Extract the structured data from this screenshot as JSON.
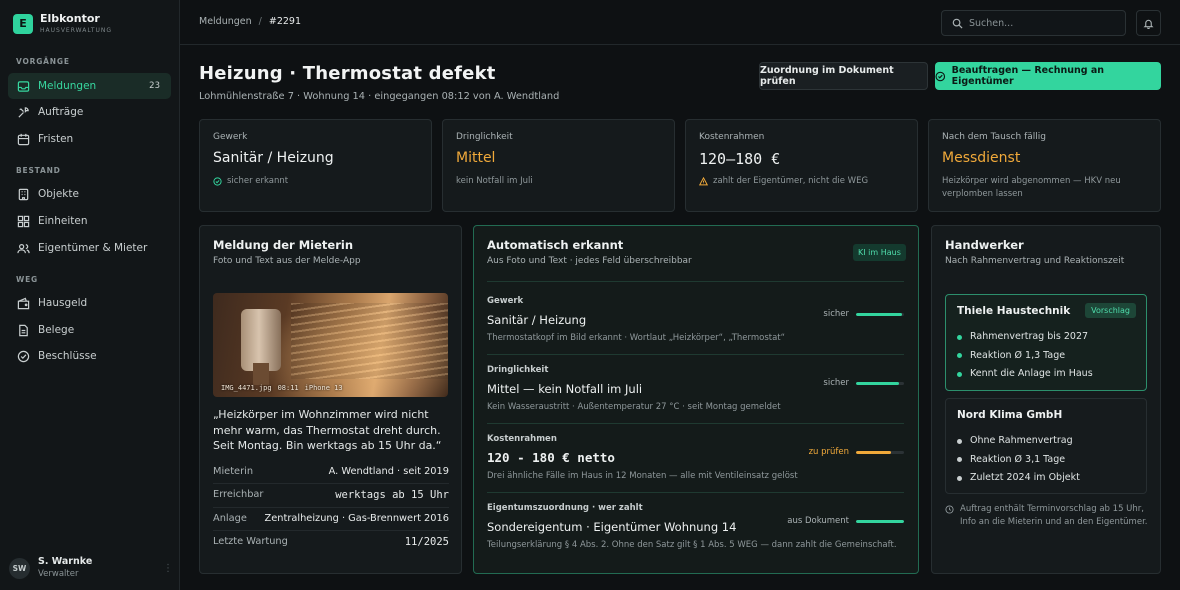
{
  "brand": {
    "logo_letter": "E",
    "name": "Elbkontor",
    "subtitle": "HAUSVERWALTUNG",
    "accent": "#33d59e"
  },
  "sidebar": {
    "sections": [
      {
        "title": "VORGÄNGE",
        "items": [
          {
            "label": "Meldungen",
            "icon": "inbox-icon",
            "count": "23",
            "active": true
          },
          {
            "label": "Aufträge",
            "icon": "tools-icon"
          },
          {
            "label": "Fristen",
            "icon": "calendar-icon"
          }
        ]
      },
      {
        "title": "BESTAND",
        "items": [
          {
            "label": "Objekte",
            "icon": "building-icon"
          },
          {
            "label": "Einheiten",
            "icon": "grid-icon"
          },
          {
            "label": "Eigentümer & Mieter",
            "icon": "users-icon"
          }
        ]
      },
      {
        "title": "WEG",
        "items": [
          {
            "label": "Hausgeld",
            "icon": "wallet-icon"
          },
          {
            "label": "Belege",
            "icon": "document-icon"
          },
          {
            "label": "Beschlüsse",
            "icon": "check-circle-icon"
          }
        ]
      }
    ],
    "user": {
      "initials": "SW",
      "name": "S. Warnke",
      "role": "Verwalter"
    }
  },
  "topbar": {
    "breadcrumb": [
      "Meldungen",
      "/",
      "#2291"
    ],
    "search_placeholder": "Suchen..."
  },
  "header": {
    "title": "Heizung · Thermostat defekt",
    "subtitle": "Lohmühlenstraße 7 · Wohnung 14 · eingegangen 08:12 von A. Wendtland",
    "secondary_button": "Zuordnung im Dokument prüfen",
    "primary_button": "Beauftragen — Rechnung an Eigentümer"
  },
  "stats": [
    {
      "label": "Gewerk",
      "value": "Sanitär / Heizung",
      "note": "sicher erkannt",
      "note_icon": "check-circle-icon"
    },
    {
      "label": "Dringlichkeit",
      "value": "Mittel",
      "note": "kein Notfall im Juli"
    },
    {
      "label": "Kostenrahmen",
      "value": "120–180 €",
      "note": "zahlt der Eigentümer, nicht die WEG",
      "note_icon": "warning-icon"
    },
    {
      "label": "Nach dem Tausch fällig",
      "value": "Messdienst",
      "note": "Heizkörper wird abgenommen — HKV neu verplomben lassen"
    }
  ],
  "report": {
    "title": "Meldung der Mieterin",
    "subtitle": "Foto und Text aus der Melde-App",
    "photo_caption": [
      "IMG_4471.jpg",
      "08:11",
      "iPhone 13"
    ],
    "quote": "„Heizkörper im Wohnzimmer wird nicht mehr warm, das Thermostat dreht durch. Seit Montag. Bin werktags ab 15 Uhr da.“",
    "details": [
      {
        "key": "Mieterin",
        "value": "A. Wendtland · seit 2019"
      },
      {
        "key": "Erreichbar",
        "value": "werktags ab 15 Uhr"
      },
      {
        "key": "Anlage",
        "value": "Zentralheizung · Gas-Brennwert 2016"
      },
      {
        "key": "Letzte Wartung",
        "value": "11/2025"
      }
    ]
  },
  "auto": {
    "title": "Automatisch erkannt",
    "subtitle": "Aus Foto und Text · jedes Feld überschreibbar",
    "badge": "KI im Haus",
    "fields": [
      {
        "label": "Gewerk",
        "value": "Sanitär / Heizung",
        "note": "Thermostatkopf im Bild erkannt · Wortlaut „Heizkörper“, „Thermostat“",
        "confidence_label": "sicher",
        "confidence": 0.95,
        "color": "#33d59e"
      },
      {
        "label": "Dringlichkeit",
        "value": "Mittel — kein Notfall im Juli",
        "note": "Kein Wasseraustritt · Außentemperatur 27 °C · seit Montag gemeldet",
        "confidence_label": "sicher",
        "confidence": 0.9,
        "color": "#33d59e"
      },
      {
        "label": "Kostenrahmen",
        "value": "120 - 180 € netto",
        "note": "Drei ähnliche Fälle im Haus in 12 Monaten — alle mit Ventileinsatz gelöst",
        "confidence_label": "zu prüfen",
        "confidence": 0.72,
        "color": "#f0a93a"
      },
      {
        "label": "Eigentumszuordnung · wer zahlt",
        "value": "Sondereigentum · Eigentümer Wohnung 14",
        "note": "Teilungserklärung § 4 Abs. 2. Ohne den Satz gilt § 1 Abs. 5 WEG — dann zahlt die Gemeinschaft.",
        "confidence_label": "aus Dokument",
        "confidence": 1.0,
        "color": "#33d59e"
      }
    ]
  },
  "contractors": {
    "title": "Handwerker",
    "subtitle": "Nach Rahmenvertrag und Reaktionszeit",
    "vendors": [
      {
        "name": "Thiele Haustechnik",
        "badge": "Vorschlag",
        "items": [
          "Rahmenvertrag bis 2027",
          "Reaktion Ø 1,3 Tage",
          "Kennt die Anlage im Haus"
        ]
      },
      {
        "name": "Nord Klima GmbH",
        "items": [
          "Ohne Rahmenvertrag",
          "Reaktion Ø 3,1 Tage",
          "Zuletzt 2024 im Objekt"
        ]
      }
    ],
    "info": "Auftrag enthält Terminvorschlag ab 15 Uhr, Info an die Mieterin und an den Eigentümer."
  }
}
